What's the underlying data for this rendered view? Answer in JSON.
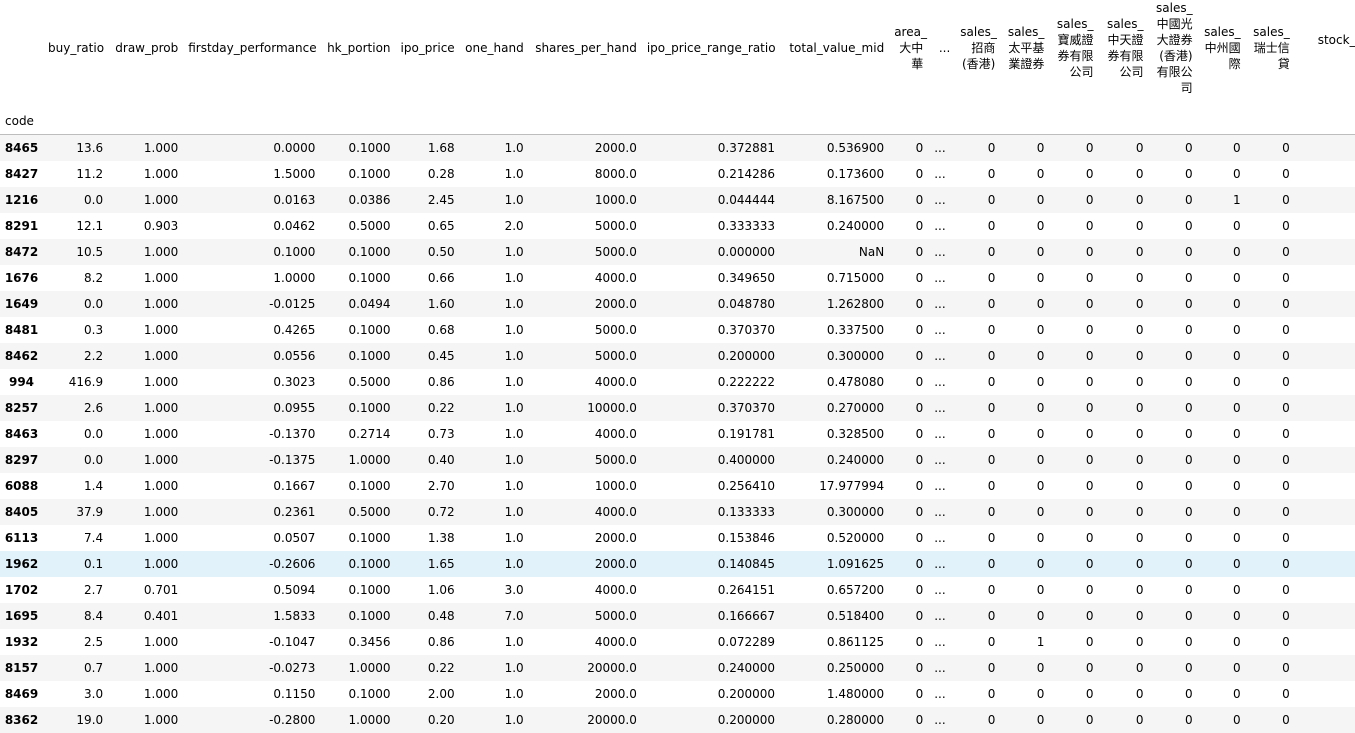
{
  "table": {
    "index_name": "code",
    "columns": [
      "buy_ratio",
      "draw_prob",
      "firstday_performance",
      "hk_portion",
      "ipo_price",
      "one_hand",
      "shares_per_hand",
      "ipo_price_range_ratio",
      "total_value_mid",
      "area_\n大中\n華",
      "...",
      "sales_\n招商\n(香港)",
      "sales_\n太平基\n業證券",
      "sales_\n寶威證\n券有限\n公司",
      "sales_\n中天證\n券有限\n公司",
      "sales_\n中國光\n大證券\n(香港)\n有限公司",
      "sales_\n中州國\n際",
      "sales_\n瑞士信\n貸",
      "stock_typ\n紅"
    ],
    "highlighted_row": 16,
    "rows": [
      [
        "8465",
        "13.6",
        "1.000",
        "0.0000",
        "0.1000",
        "1.68",
        "1.0",
        "2000.0",
        "0.372881",
        "0.536900",
        "0",
        "...",
        "0",
        "0",
        "0",
        "0",
        "0",
        "0",
        "0",
        ""
      ],
      [
        "8427",
        "11.2",
        "1.000",
        "1.5000",
        "0.1000",
        "0.28",
        "1.0",
        "8000.0",
        "0.214286",
        "0.173600",
        "0",
        "...",
        "0",
        "0",
        "0",
        "0",
        "0",
        "0",
        "0",
        ""
      ],
      [
        "1216",
        "0.0",
        "1.000",
        "0.0163",
        "0.0386",
        "2.45",
        "1.0",
        "1000.0",
        "0.044444",
        "8.167500",
        "0",
        "...",
        "0",
        "0",
        "0",
        "0",
        "0",
        "1",
        "0",
        ""
      ],
      [
        "8291",
        "12.1",
        "0.903",
        "0.0462",
        "0.5000",
        "0.65",
        "2.0",
        "5000.0",
        "0.333333",
        "0.240000",
        "0",
        "...",
        "0",
        "0",
        "0",
        "0",
        "0",
        "0",
        "0",
        ""
      ],
      [
        "8472",
        "10.5",
        "1.000",
        "0.1000",
        "0.1000",
        "0.50",
        "1.0",
        "5000.0",
        "0.000000",
        "NaN",
        "0",
        "...",
        "0",
        "0",
        "0",
        "0",
        "0",
        "0",
        "0",
        ""
      ],
      [
        "1676",
        "8.2",
        "1.000",
        "1.0000",
        "0.1000",
        "0.66",
        "1.0",
        "4000.0",
        "0.349650",
        "0.715000",
        "0",
        "...",
        "0",
        "0",
        "0",
        "0",
        "0",
        "0",
        "0",
        ""
      ],
      [
        "1649",
        "0.0",
        "1.000",
        "-0.0125",
        "0.0494",
        "1.60",
        "1.0",
        "2000.0",
        "0.048780",
        "1.262800",
        "0",
        "...",
        "0",
        "0",
        "0",
        "0",
        "0",
        "0",
        "0",
        ""
      ],
      [
        "8481",
        "0.3",
        "1.000",
        "0.4265",
        "0.1000",
        "0.68",
        "1.0",
        "5000.0",
        "0.370370",
        "0.337500",
        "0",
        "...",
        "0",
        "0",
        "0",
        "0",
        "0",
        "0",
        "0",
        ""
      ],
      [
        "8462",
        "2.2",
        "1.000",
        "0.0556",
        "0.1000",
        "0.45",
        "1.0",
        "5000.0",
        "0.200000",
        "0.300000",
        "0",
        "...",
        "0",
        "0",
        "0",
        "0",
        "0",
        "0",
        "0",
        ""
      ],
      [
        "994",
        "416.9",
        "1.000",
        "0.3023",
        "0.5000",
        "0.86",
        "1.0",
        "4000.0",
        "0.222222",
        "0.478080",
        "0",
        "...",
        "0",
        "0",
        "0",
        "0",
        "0",
        "0",
        "0",
        ""
      ],
      [
        "8257",
        "2.6",
        "1.000",
        "0.0955",
        "0.1000",
        "0.22",
        "1.0",
        "10000.0",
        "0.370370",
        "0.270000",
        "0",
        "...",
        "0",
        "0",
        "0",
        "0",
        "0",
        "0",
        "0",
        ""
      ],
      [
        "8463",
        "0.0",
        "1.000",
        "-0.1370",
        "0.2714",
        "0.73",
        "1.0",
        "4000.0",
        "0.191781",
        "0.328500",
        "0",
        "...",
        "0",
        "0",
        "0",
        "0",
        "0",
        "0",
        "0",
        ""
      ],
      [
        "8297",
        "0.0",
        "1.000",
        "-0.1375",
        "1.0000",
        "0.40",
        "1.0",
        "5000.0",
        "0.400000",
        "0.240000",
        "0",
        "...",
        "0",
        "0",
        "0",
        "0",
        "0",
        "0",
        "0",
        ""
      ],
      [
        "6088",
        "1.4",
        "1.000",
        "0.1667",
        "0.1000",
        "2.70",
        "1.0",
        "1000.0",
        "0.256410",
        "17.977994",
        "0",
        "...",
        "0",
        "0",
        "0",
        "0",
        "0",
        "0",
        "0",
        ""
      ],
      [
        "8405",
        "37.9",
        "1.000",
        "0.2361",
        "0.5000",
        "0.72",
        "1.0",
        "4000.0",
        "0.133333",
        "0.300000",
        "0",
        "...",
        "0",
        "0",
        "0",
        "0",
        "0",
        "0",
        "0",
        ""
      ],
      [
        "6113",
        "7.4",
        "1.000",
        "0.0507",
        "0.1000",
        "1.38",
        "1.0",
        "2000.0",
        "0.153846",
        "0.520000",
        "0",
        "...",
        "0",
        "0",
        "0",
        "0",
        "0",
        "0",
        "0",
        ""
      ],
      [
        "1962",
        "0.1",
        "1.000",
        "-0.2606",
        "0.1000",
        "1.65",
        "1.0",
        "2000.0",
        "0.140845",
        "1.091625",
        "0",
        "...",
        "0",
        "0",
        "0",
        "0",
        "0",
        "0",
        "0",
        ""
      ],
      [
        "1702",
        "2.7",
        "0.701",
        "0.5094",
        "0.1000",
        "1.06",
        "3.0",
        "4000.0",
        "0.264151",
        "0.657200",
        "0",
        "...",
        "0",
        "0",
        "0",
        "0",
        "0",
        "0",
        "0",
        ""
      ],
      [
        "1695",
        "8.4",
        "0.401",
        "1.5833",
        "0.1000",
        "0.48",
        "7.0",
        "5000.0",
        "0.166667",
        "0.518400",
        "0",
        "...",
        "0",
        "0",
        "0",
        "0",
        "0",
        "0",
        "0",
        ""
      ],
      [
        "1932",
        "2.5",
        "1.000",
        "-0.1047",
        "0.3456",
        "0.86",
        "1.0",
        "4000.0",
        "0.072289",
        "0.861125",
        "0",
        "...",
        "0",
        "1",
        "0",
        "0",
        "0",
        "0",
        "0",
        ""
      ],
      [
        "8157",
        "0.7",
        "1.000",
        "-0.0273",
        "1.0000",
        "0.22",
        "1.0",
        "20000.0",
        "0.240000",
        "0.250000",
        "0",
        "...",
        "0",
        "0",
        "0",
        "0",
        "0",
        "0",
        "0",
        ""
      ],
      [
        "8469",
        "3.0",
        "1.000",
        "0.1150",
        "0.1000",
        "2.00",
        "1.0",
        "2000.0",
        "0.200000",
        "1.480000",
        "0",
        "...",
        "0",
        "0",
        "0",
        "0",
        "0",
        "0",
        "0",
        ""
      ],
      [
        "8362",
        "19.0",
        "1.000",
        "-0.2800",
        "1.0000",
        "0.20",
        "1.0",
        "20000.0",
        "0.200000",
        "0.280000",
        "0",
        "...",
        "0",
        "0",
        "0",
        "0",
        "0",
        "0",
        "0",
        ""
      ]
    ]
  }
}
